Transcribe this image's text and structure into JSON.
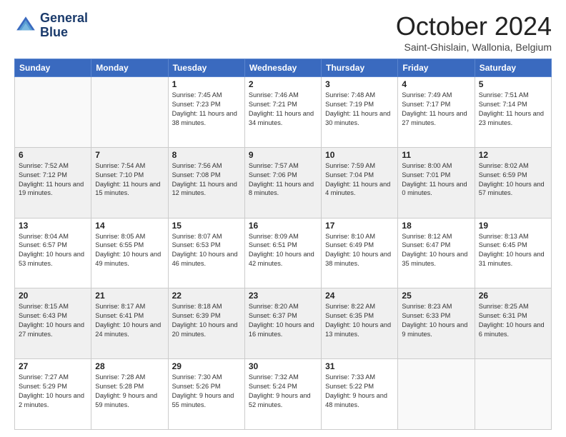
{
  "header": {
    "logo_line1": "General",
    "logo_line2": "Blue",
    "title": "October 2024",
    "location": "Saint-Ghislain, Wallonia, Belgium"
  },
  "weekdays": [
    "Sunday",
    "Monday",
    "Tuesday",
    "Wednesday",
    "Thursday",
    "Friday",
    "Saturday"
  ],
  "weeks": [
    [
      {
        "day": "",
        "empty": true
      },
      {
        "day": "",
        "empty": true
      },
      {
        "day": "1",
        "sunrise": "Sunrise: 7:45 AM",
        "sunset": "Sunset: 7:23 PM",
        "daylight": "Daylight: 11 hours and 38 minutes."
      },
      {
        "day": "2",
        "sunrise": "Sunrise: 7:46 AM",
        "sunset": "Sunset: 7:21 PM",
        "daylight": "Daylight: 11 hours and 34 minutes."
      },
      {
        "day": "3",
        "sunrise": "Sunrise: 7:48 AM",
        "sunset": "Sunset: 7:19 PM",
        "daylight": "Daylight: 11 hours and 30 minutes."
      },
      {
        "day": "4",
        "sunrise": "Sunrise: 7:49 AM",
        "sunset": "Sunset: 7:17 PM",
        "daylight": "Daylight: 11 hours and 27 minutes."
      },
      {
        "day": "5",
        "sunrise": "Sunrise: 7:51 AM",
        "sunset": "Sunset: 7:14 PM",
        "daylight": "Daylight: 11 hours and 23 minutes."
      }
    ],
    [
      {
        "day": "6",
        "sunrise": "Sunrise: 7:52 AM",
        "sunset": "Sunset: 7:12 PM",
        "daylight": "Daylight: 11 hours and 19 minutes."
      },
      {
        "day": "7",
        "sunrise": "Sunrise: 7:54 AM",
        "sunset": "Sunset: 7:10 PM",
        "daylight": "Daylight: 11 hours and 15 minutes."
      },
      {
        "day": "8",
        "sunrise": "Sunrise: 7:56 AM",
        "sunset": "Sunset: 7:08 PM",
        "daylight": "Daylight: 11 hours and 12 minutes."
      },
      {
        "day": "9",
        "sunrise": "Sunrise: 7:57 AM",
        "sunset": "Sunset: 7:06 PM",
        "daylight": "Daylight: 11 hours and 8 minutes."
      },
      {
        "day": "10",
        "sunrise": "Sunrise: 7:59 AM",
        "sunset": "Sunset: 7:04 PM",
        "daylight": "Daylight: 11 hours and 4 minutes."
      },
      {
        "day": "11",
        "sunrise": "Sunrise: 8:00 AM",
        "sunset": "Sunset: 7:01 PM",
        "daylight": "Daylight: 11 hours and 0 minutes."
      },
      {
        "day": "12",
        "sunrise": "Sunrise: 8:02 AM",
        "sunset": "Sunset: 6:59 PM",
        "daylight": "Daylight: 10 hours and 57 minutes."
      }
    ],
    [
      {
        "day": "13",
        "sunrise": "Sunrise: 8:04 AM",
        "sunset": "Sunset: 6:57 PM",
        "daylight": "Daylight: 10 hours and 53 minutes."
      },
      {
        "day": "14",
        "sunrise": "Sunrise: 8:05 AM",
        "sunset": "Sunset: 6:55 PM",
        "daylight": "Daylight: 10 hours and 49 minutes."
      },
      {
        "day": "15",
        "sunrise": "Sunrise: 8:07 AM",
        "sunset": "Sunset: 6:53 PM",
        "daylight": "Daylight: 10 hours and 46 minutes."
      },
      {
        "day": "16",
        "sunrise": "Sunrise: 8:09 AM",
        "sunset": "Sunset: 6:51 PM",
        "daylight": "Daylight: 10 hours and 42 minutes."
      },
      {
        "day": "17",
        "sunrise": "Sunrise: 8:10 AM",
        "sunset": "Sunset: 6:49 PM",
        "daylight": "Daylight: 10 hours and 38 minutes."
      },
      {
        "day": "18",
        "sunrise": "Sunrise: 8:12 AM",
        "sunset": "Sunset: 6:47 PM",
        "daylight": "Daylight: 10 hours and 35 minutes."
      },
      {
        "day": "19",
        "sunrise": "Sunrise: 8:13 AM",
        "sunset": "Sunset: 6:45 PM",
        "daylight": "Daylight: 10 hours and 31 minutes."
      }
    ],
    [
      {
        "day": "20",
        "sunrise": "Sunrise: 8:15 AM",
        "sunset": "Sunset: 6:43 PM",
        "daylight": "Daylight: 10 hours and 27 minutes."
      },
      {
        "day": "21",
        "sunrise": "Sunrise: 8:17 AM",
        "sunset": "Sunset: 6:41 PM",
        "daylight": "Daylight: 10 hours and 24 minutes."
      },
      {
        "day": "22",
        "sunrise": "Sunrise: 8:18 AM",
        "sunset": "Sunset: 6:39 PM",
        "daylight": "Daylight: 10 hours and 20 minutes."
      },
      {
        "day": "23",
        "sunrise": "Sunrise: 8:20 AM",
        "sunset": "Sunset: 6:37 PM",
        "daylight": "Daylight: 10 hours and 16 minutes."
      },
      {
        "day": "24",
        "sunrise": "Sunrise: 8:22 AM",
        "sunset": "Sunset: 6:35 PM",
        "daylight": "Daylight: 10 hours and 13 minutes."
      },
      {
        "day": "25",
        "sunrise": "Sunrise: 8:23 AM",
        "sunset": "Sunset: 6:33 PM",
        "daylight": "Daylight: 10 hours and 9 minutes."
      },
      {
        "day": "26",
        "sunrise": "Sunrise: 8:25 AM",
        "sunset": "Sunset: 6:31 PM",
        "daylight": "Daylight: 10 hours and 6 minutes."
      }
    ],
    [
      {
        "day": "27",
        "sunrise": "Sunrise: 7:27 AM",
        "sunset": "Sunset: 5:29 PM",
        "daylight": "Daylight: 10 hours and 2 minutes."
      },
      {
        "day": "28",
        "sunrise": "Sunrise: 7:28 AM",
        "sunset": "Sunset: 5:28 PM",
        "daylight": "Daylight: 9 hours and 59 minutes."
      },
      {
        "day": "29",
        "sunrise": "Sunrise: 7:30 AM",
        "sunset": "Sunset: 5:26 PM",
        "daylight": "Daylight: 9 hours and 55 minutes."
      },
      {
        "day": "30",
        "sunrise": "Sunrise: 7:32 AM",
        "sunset": "Sunset: 5:24 PM",
        "daylight": "Daylight: 9 hours and 52 minutes."
      },
      {
        "day": "31",
        "sunrise": "Sunrise: 7:33 AM",
        "sunset": "Sunset: 5:22 PM",
        "daylight": "Daylight: 9 hours and 48 minutes."
      },
      {
        "day": "",
        "empty": true
      },
      {
        "day": "",
        "empty": true
      }
    ]
  ]
}
